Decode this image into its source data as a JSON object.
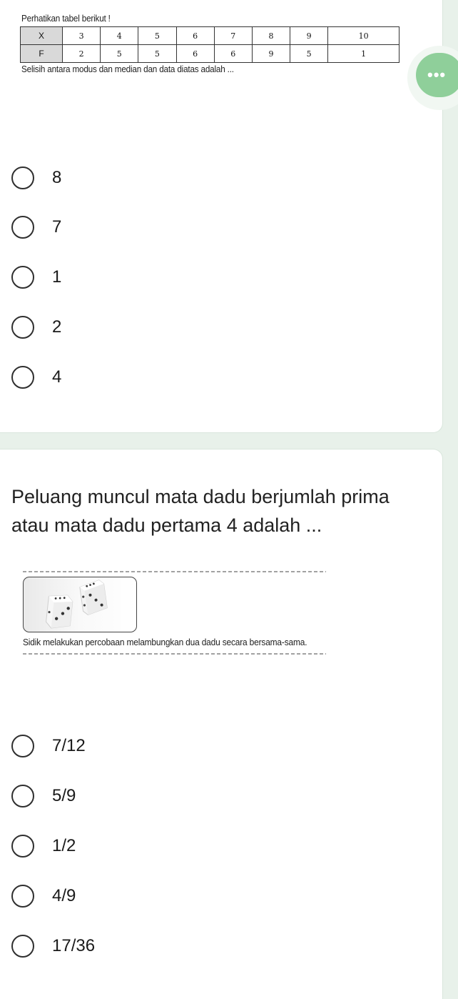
{
  "question1": {
    "heading": "Perhatikan tabel berikut !",
    "table": {
      "rows": [
        {
          "header": "X",
          "values": [
            "3",
            "4",
            "5",
            "6",
            "7",
            "8",
            "9",
            "10"
          ]
        },
        {
          "header": "F",
          "values": [
            "2",
            "5",
            "5",
            "6",
            "6",
            "9",
            "5",
            "1"
          ]
        }
      ]
    },
    "prompt": "Selisih antara modus dan median dan data diatas adalah ...",
    "options": [
      "8",
      "7",
      "1",
      "2",
      "4"
    ]
  },
  "fab": {
    "icon": "more-dots-icon",
    "glyph": "•••",
    "color": "#8fcf9a"
  },
  "question2": {
    "title": "Peluang muncul mata dadu berjumlah prima atau mata dadu pertama 4 adalah ...",
    "caption": "Sidik melakukan percobaan melambungkan dua dadu secara bersama-sama.",
    "image_icon": "dice-image",
    "options": [
      "7/12",
      "5/9",
      "1/2",
      "4/9",
      "17/36"
    ]
  },
  "colors": {
    "page_background": "#e8f1ea",
    "card": "#ffffff",
    "accent_green": "#8fcf9a"
  }
}
